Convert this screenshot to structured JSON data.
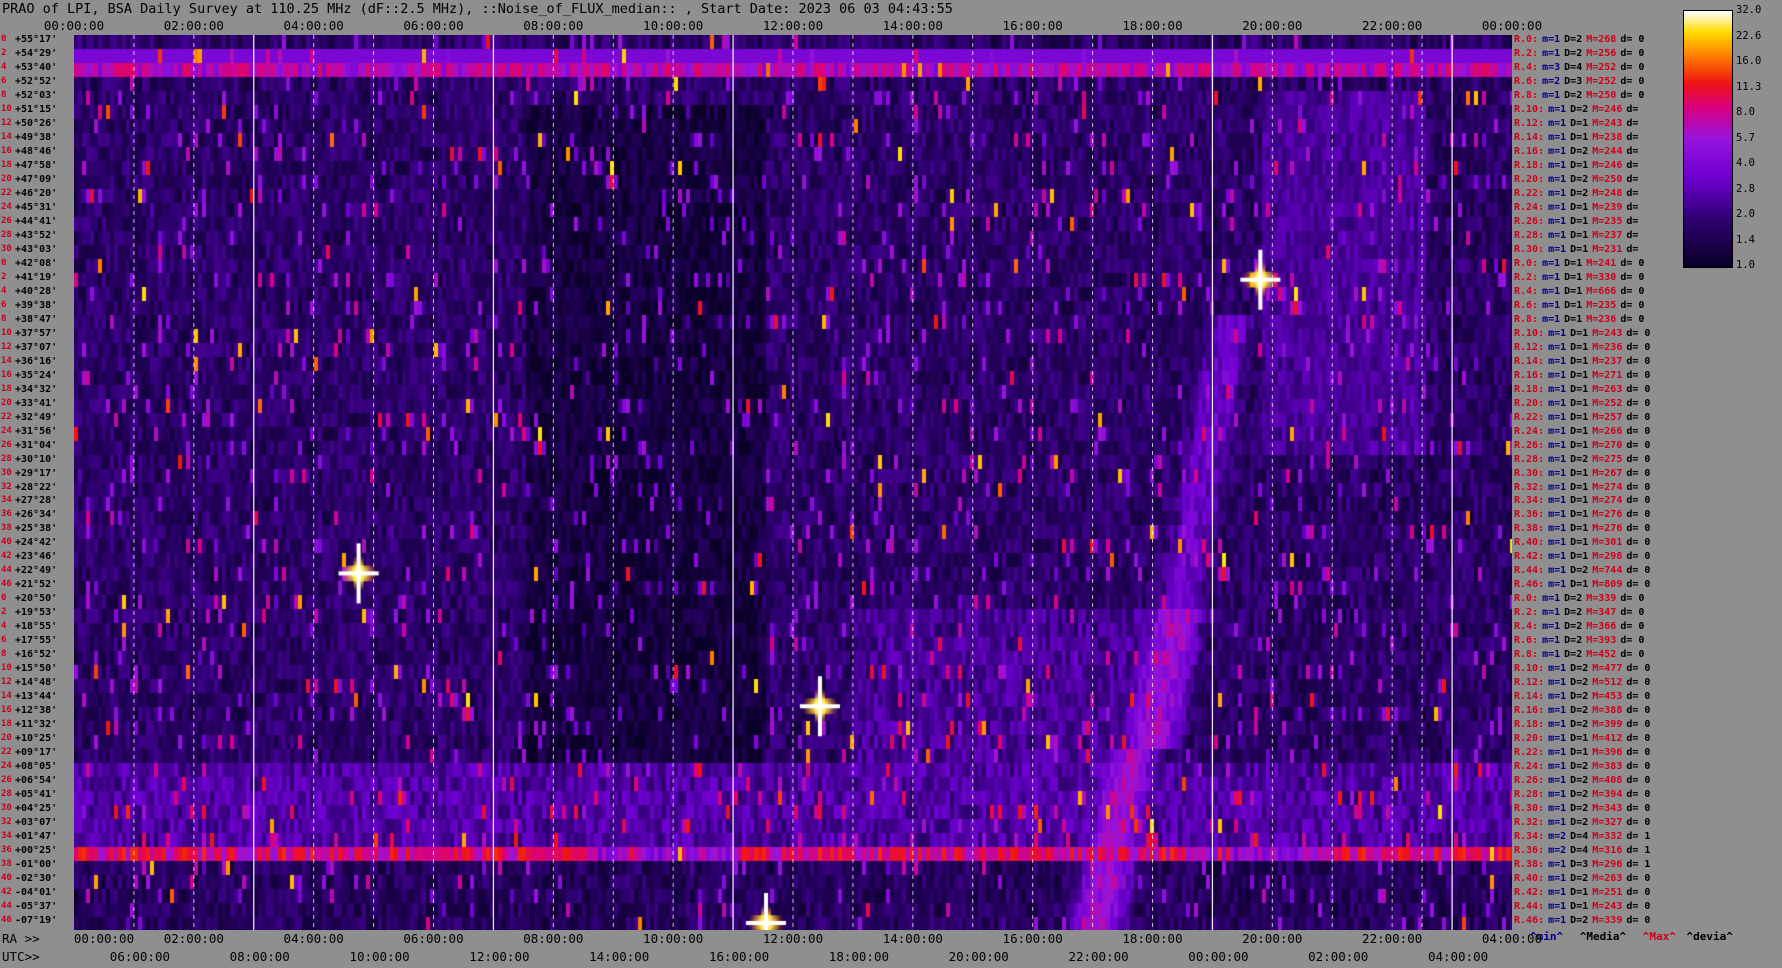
{
  "title": "PRAO of LPI, BSA Daily Survey at 110.25 MHz (dF::2.5 MHz), ::Noise_of_FLUX_median:: , Start Date: 2023 06 03 04:43:55",
  "ra_prefix": "RA >>",
  "utc_prefix": "UTC>>",
  "colors": {
    "background": "#8f8f8f",
    "stat_label": "#d0001c",
    "stat_min": "#00008a"
  },
  "colorbar": {
    "labels": [
      "32.0",
      "22.6",
      "16.0",
      "11.3",
      "8.0",
      "5.7",
      "4.0",
      "2.8",
      "2.0",
      "1.4",
      "1.0"
    ],
    "scale": "log",
    "colormap": "gnuplot-like (black-purple-red-yellow-white)"
  },
  "legend": {
    "min": "^min^",
    "median": "^Media^",
    "max": "^Max^",
    "devia": "^devia^"
  },
  "chart_data": {
    "type": "heatmap",
    "title": "PRAO of LPI, BSA Daily Survey at 110.25 MHz (dF::2.5 MHz), ::Noise_of_FLUX_median:: , Start Date: 2023 06 03 04:43:55",
    "xlabel": "RA / UTC",
    "ylabel": "Declination",
    "top_x_ticks": [
      "00:00:00",
      "02:00:00",
      "04:00:00",
      "06:00:00",
      "08:00:00",
      "10:00:00",
      "12:00:00",
      "14:00:00",
      "16:00:00",
      "18:00:00",
      "20:00:00",
      "22:00:00",
      "00:00:00"
    ],
    "bottom_ra_ticks": [
      "00:00:00",
      "02:00:00",
      "04:00:00",
      "06:00:00",
      "08:00:00",
      "10:00:00",
      "12:00:00",
      "14:00:00",
      "20:00:00",
      "16:00:00",
      "18:00:00",
      "20:00:00",
      "22:00:00",
      "04:00:00"
    ],
    "bottom_utc_ticks": [
      "06:00:00",
      "08:00:00",
      "10:00:00",
      "12:00:00",
      "14:00:00",
      "16:00:00",
      "18:00:00",
      "20:00:00",
      "22:00:00",
      "00:00:00",
      "02:00:00",
      "04:00:00"
    ],
    "y_ticks": [
      "+55°17'",
      "+54°29'",
      "+53°40'",
      "+52°52'",
      "+52°03'",
      "+51°15'",
      "+50°26'",
      "+49°38'",
      "+48°46'",
      "+47°58'",
      "+47°09'",
      "+46°20'",
      "+45°31'",
      "+44°41'",
      "+43°52'",
      "+43°03'",
      "+42°08'",
      "+41°19'",
      "+40°28'",
      "+39°38'",
      "+38°47'",
      "+37°57'",
      "+37°07'",
      "+36°16'",
      "+35°24'",
      "+34°32'",
      "+33°41'",
      "+32°49'",
      "+31°56'",
      "+31°04'",
      "+30°10'",
      "+29°17'",
      "+28°22'",
      "+27°28'",
      "+26°34'",
      "+25°38'",
      "+24°42'",
      "+23°46'",
      "+22°49'",
      "+21°52'",
      "+20°50'",
      "+19°53'",
      "+18°55'",
      "+17°55'",
      "+16°52'",
      "+15°50'",
      "+14°48'",
      "+13°44'",
      "+12°38'",
      "+11°32'",
      "+10°25'",
      "+09°17'",
      "+08°05'",
      "+06°54'",
      "+05°41'",
      "+04°25'",
      "+03°07'",
      "+01°47'",
      "+00°25'",
      "-01°00'",
      "-02°30'",
      "-04°01'",
      "-05°37'",
      "-07°19'"
    ],
    "y_indices": [
      "0",
      "2",
      "4",
      "6",
      "8",
      "10",
      "12",
      "14",
      "16",
      "18",
      "20",
      "22",
      "24",
      "26",
      "28",
      "30",
      "0",
      "2",
      "4",
      "6",
      "8",
      "10",
      "12",
      "14",
      "16",
      "18",
      "20",
      "22",
      "24",
      "26",
      "28",
      "30",
      "32",
      "34",
      "36",
      "38",
      "40",
      "42",
      "44",
      "46",
      "0",
      "2",
      "4",
      "6",
      "8",
      "10",
      "12",
      "14",
      "16",
      "18",
      "20",
      "22",
      "24",
      "26",
      "28",
      "30",
      "32",
      "34",
      "36",
      "38",
      "40",
      "42",
      "44",
      "46"
    ],
    "features": [
      {
        "kind": "point_source",
        "x_hour": 4.75,
        "row": 38.5,
        "intensity": 32
      },
      {
        "kind": "point_source",
        "x_hour": 19.8,
        "row": 17.5,
        "intensity": 32
      },
      {
        "kind": "point_source",
        "x_hour": 12.45,
        "row": 48,
        "intensity": 20
      },
      {
        "kind": "point_source",
        "x_hour": 11.55,
        "row": 63.5,
        "intensity": 32
      },
      {
        "kind": "band_row",
        "row": 2.5,
        "intensity": 8
      },
      {
        "kind": "band_row",
        "row": 58.5,
        "intensity": 11
      }
    ]
  },
  "stats": [
    {
      "r": "R.0:",
      "m": "m=1",
      "d": "D=2",
      "mm": "M=268",
      "dd": "d= 0"
    },
    {
      "r": "R.2:",
      "m": "m=1",
      "d": "D=2",
      "mm": "M=256",
      "dd": "d= 0"
    },
    {
      "r": "R.4:",
      "m": "m=3",
      "d": "D=4",
      "mm": "M=252",
      "dd": "d= 0"
    },
    {
      "r": "R.6:",
      "m": "m=2",
      "d": "D=3",
      "mm": "M=252",
      "dd": "d= 0"
    },
    {
      "r": "R.8:",
      "m": "m=1",
      "d": "D=2",
      "mm": "M=250",
      "dd": "d= 0"
    },
    {
      "r": "R.10:",
      "m": "m=1",
      "d": "D=2",
      "mm": "M=246",
      "dd": "d="
    },
    {
      "r": "R.12:",
      "m": "m=1",
      "d": "D=1",
      "mm": "M=243",
      "dd": "d="
    },
    {
      "r": "R.14:",
      "m": "m=1",
      "d": "D=1",
      "mm": "M=238",
      "dd": "d="
    },
    {
      "r": "R.16:",
      "m": "m=1",
      "d": "D=2",
      "mm": "M=244",
      "dd": "d="
    },
    {
      "r": "R.18:",
      "m": "m=1",
      "d": "D=1",
      "mm": "M=246",
      "dd": "d="
    },
    {
      "r": "R.20:",
      "m": "m=1",
      "d": "D=2",
      "mm": "M=250",
      "dd": "d="
    },
    {
      "r": "R.22:",
      "m": "m=1",
      "d": "D=2",
      "mm": "M=248",
      "dd": "d="
    },
    {
      "r": "R.24:",
      "m": "m=1",
      "d": "D=1",
      "mm": "M=239",
      "dd": "d="
    },
    {
      "r": "R.26:",
      "m": "m=1",
      "d": "D=1",
      "mm": "M=235",
      "dd": "d="
    },
    {
      "r": "R.28:",
      "m": "m=1",
      "d": "D=1",
      "mm": "M=237",
      "dd": "d="
    },
    {
      "r": "R.30:",
      "m": "m=1",
      "d": "D=1",
      "mm": "M=231",
      "dd": "d="
    },
    {
      "r": "R.0:",
      "m": "m=1",
      "d": "D=1",
      "mm": "M=241",
      "dd": "d= 0"
    },
    {
      "r": "R.2:",
      "m": "m=1",
      "d": "D=1",
      "mm": "M=330",
      "dd": "d= 0"
    },
    {
      "r": "R.4:",
      "m": "m=1",
      "d": "D=1",
      "mm": "M=666",
      "dd": "d= 0"
    },
    {
      "r": "R.6:",
      "m": "m=1",
      "d": "D=1",
      "mm": "M=235",
      "dd": "d= 0"
    },
    {
      "r": "R.8:",
      "m": "m=1",
      "d": "D=1",
      "mm": "M=236",
      "dd": "d= 0"
    },
    {
      "r": "R.10:",
      "m": "m=1",
      "d": "D=1",
      "mm": "M=243",
      "dd": "d= 0"
    },
    {
      "r": "R.12:",
      "m": "m=1",
      "d": "D=1",
      "mm": "M=236",
      "dd": "d= 0"
    },
    {
      "r": "R.14:",
      "m": "m=1",
      "d": "D=1",
      "mm": "M=237",
      "dd": "d= 0"
    },
    {
      "r": "R.16:",
      "m": "m=1",
      "d": "D=1",
      "mm": "M=271",
      "dd": "d= 0"
    },
    {
      "r": "R.18:",
      "m": "m=1",
      "d": "D=1",
      "mm": "M=263",
      "dd": "d= 0"
    },
    {
      "r": "R.20:",
      "m": "m=1",
      "d": "D=1",
      "mm": "M=252",
      "dd": "d= 0"
    },
    {
      "r": "R.22:",
      "m": "m=1",
      "d": "D=1",
      "mm": "M=257",
      "dd": "d= 0"
    },
    {
      "r": "R.24:",
      "m": "m=1",
      "d": "D=1",
      "mm": "M=266",
      "dd": "d= 0"
    },
    {
      "r": "R.26:",
      "m": "m=1",
      "d": "D=1",
      "mm": "M=270",
      "dd": "d= 0"
    },
    {
      "r": "R.28:",
      "m": "m=1",
      "d": "D=2",
      "mm": "M=275",
      "dd": "d= 0"
    },
    {
      "r": "R.30:",
      "m": "m=1",
      "d": "D=1",
      "mm": "M=267",
      "dd": "d= 0"
    },
    {
      "r": "R.32:",
      "m": "m=1",
      "d": "D=1",
      "mm": "M=274",
      "dd": "d= 0"
    },
    {
      "r": "R.34:",
      "m": "m=1",
      "d": "D=1",
      "mm": "M=274",
      "dd": "d= 0"
    },
    {
      "r": "R.36:",
      "m": "m=1",
      "d": "D=1",
      "mm": "M=276",
      "dd": "d= 0"
    },
    {
      "r": "R.38:",
      "m": "m=1",
      "d": "D=1",
      "mm": "M=276",
      "dd": "d= 0"
    },
    {
      "r": "R.40:",
      "m": "m=1",
      "d": "D=1",
      "mm": "M=301",
      "dd": "d= 0"
    },
    {
      "r": "R.42:",
      "m": "m=1",
      "d": "D=1",
      "mm": "M=298",
      "dd": "d= 0"
    },
    {
      "r": "R.44:",
      "m": "m=1",
      "d": "D=2",
      "mm": "M=744",
      "dd": "d= 0"
    },
    {
      "r": "R.46:",
      "m": "m=1",
      "d": "D=1",
      "mm": "M=809",
      "dd": "d= 0"
    },
    {
      "r": "R.0:",
      "m": "m=1",
      "d": "D=2",
      "mm": "M=339",
      "dd": "d= 0"
    },
    {
      "r": "R.2:",
      "m": "m=1",
      "d": "D=2",
      "mm": "M=347",
      "dd": "d= 0"
    },
    {
      "r": "R.4:",
      "m": "m=1",
      "d": "D=2",
      "mm": "M=366",
      "dd": "d= 0"
    },
    {
      "r": "R.6:",
      "m": "m=1",
      "d": "D=2",
      "mm": "M=393",
      "dd": "d= 0"
    },
    {
      "r": "R.8:",
      "m": "m=1",
      "d": "D=2",
      "mm": "M=452",
      "dd": "d= 0"
    },
    {
      "r": "R.10:",
      "m": "m=1",
      "d": "D=2",
      "mm": "M=477",
      "dd": "d= 0"
    },
    {
      "r": "R.12:",
      "m": "m=1",
      "d": "D=2",
      "mm": "M=512",
      "dd": "d= 0"
    },
    {
      "r": "R.14:",
      "m": "m=1",
      "d": "D=2",
      "mm": "M=453",
      "dd": "d= 0"
    },
    {
      "r": "R.16:",
      "m": "m=1",
      "d": "D=2",
      "mm": "M=388",
      "dd": "d= 0"
    },
    {
      "r": "R.18:",
      "m": "m=1",
      "d": "D=2",
      "mm": "M=399",
      "dd": "d= 0"
    },
    {
      "r": "R.20:",
      "m": "m=1",
      "d": "D=1",
      "mm": "M=412",
      "dd": "d= 0"
    },
    {
      "r": "R.22:",
      "m": "m=1",
      "d": "D=1",
      "mm": "M=396",
      "dd": "d= 0"
    },
    {
      "r": "R.24:",
      "m": "m=1",
      "d": "D=2",
      "mm": "M=383",
      "dd": "d= 0"
    },
    {
      "r": "R.26:",
      "m": "m=1",
      "d": "D=2",
      "mm": "M=408",
      "dd": "d= 0"
    },
    {
      "r": "R.28:",
      "m": "m=1",
      "d": "D=2",
      "mm": "M=394",
      "dd": "d= 0"
    },
    {
      "r": "R.30:",
      "m": "m=1",
      "d": "D=2",
      "mm": "M=343",
      "dd": "d= 0"
    },
    {
      "r": "R.32:",
      "m": "m=1",
      "d": "D=2",
      "mm": "M=327",
      "dd": "d= 0"
    },
    {
      "r": "R.34:",
      "m": "m=2",
      "d": "D=4",
      "mm": "M=332",
      "dd": "d= 1"
    },
    {
      "r": "R.36:",
      "m": "m=2",
      "d": "D=4",
      "mm": "M=316",
      "dd": "d= 1"
    },
    {
      "r": "R.38:",
      "m": "m=1",
      "d": "D=3",
      "mm": "M=296",
      "dd": "d= 1"
    },
    {
      "r": "R.40:",
      "m": "m=1",
      "d": "D=2",
      "mm": "M=263",
      "dd": "d= 0"
    },
    {
      "r": "R.42:",
      "m": "m=1",
      "d": "D=1",
      "mm": "M=251",
      "dd": "d= 0"
    },
    {
      "r": "R.44:",
      "m": "m=1",
      "d": "D=1",
      "mm": "M=243",
      "dd": "d= 0"
    },
    {
      "r": "R.46:",
      "m": "m=1",
      "d": "D=2",
      "mm": "M=339",
      "dd": "d= 0"
    }
  ]
}
